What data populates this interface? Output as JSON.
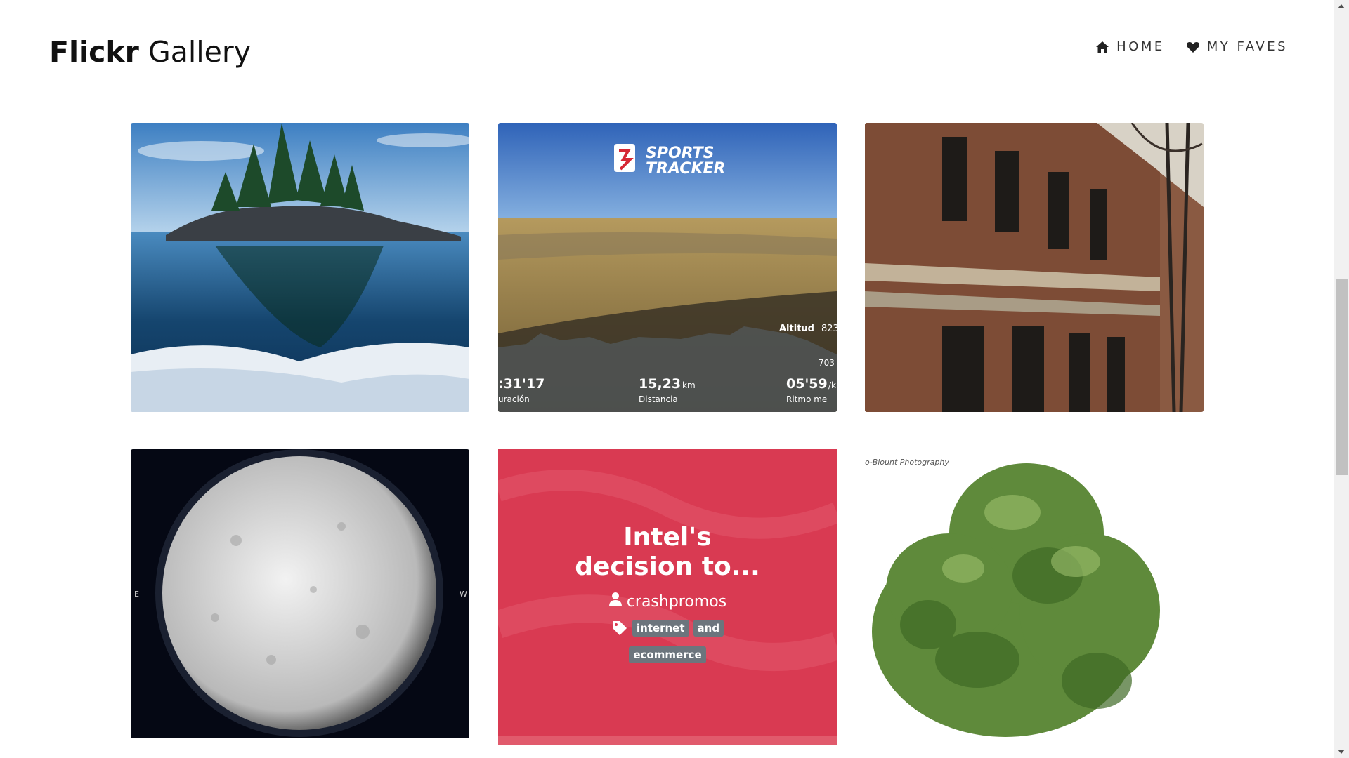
{
  "brand": {
    "bold": "Flickr",
    "light": "Gallery"
  },
  "nav": {
    "home": {
      "label": "HOME",
      "icon": "home-icon"
    },
    "faves": {
      "label": "MY FAVES",
      "icon": "heart-icon"
    }
  },
  "cards": [
    {
      "name": "lake-island-photo"
    },
    {
      "name": "sports-tracker-photo",
      "overlay_text": {
        "logo_top": "SPORTS",
        "logo_bottom": "TRACKER",
        "altitud": "Altitud",
        "alt_high": "823",
        "alt_low": "703",
        "duration": ":31'17",
        "duration_label": "uración",
        "distance": "15,23",
        "distance_unit": "km",
        "distance_label": "Distancia",
        "pace": "05'59",
        "pace_unit": "/k",
        "pace_label": "Ritmo me"
      }
    },
    {
      "name": "old-building-photo"
    },
    {
      "name": "moon-photo",
      "labels": {
        "east": "E",
        "west": "W"
      }
    },
    {
      "name": "post-card",
      "title": "Intel's decision to...",
      "user": "crashpromos",
      "tags": [
        "internet",
        "and",
        "ecommerce"
      ]
    },
    {
      "name": "tree-photo",
      "watermark": "o-Blount Photography"
    }
  ],
  "colors": {
    "overlay_bg": "#d93a52",
    "tag_bg": "#6c757d"
  }
}
